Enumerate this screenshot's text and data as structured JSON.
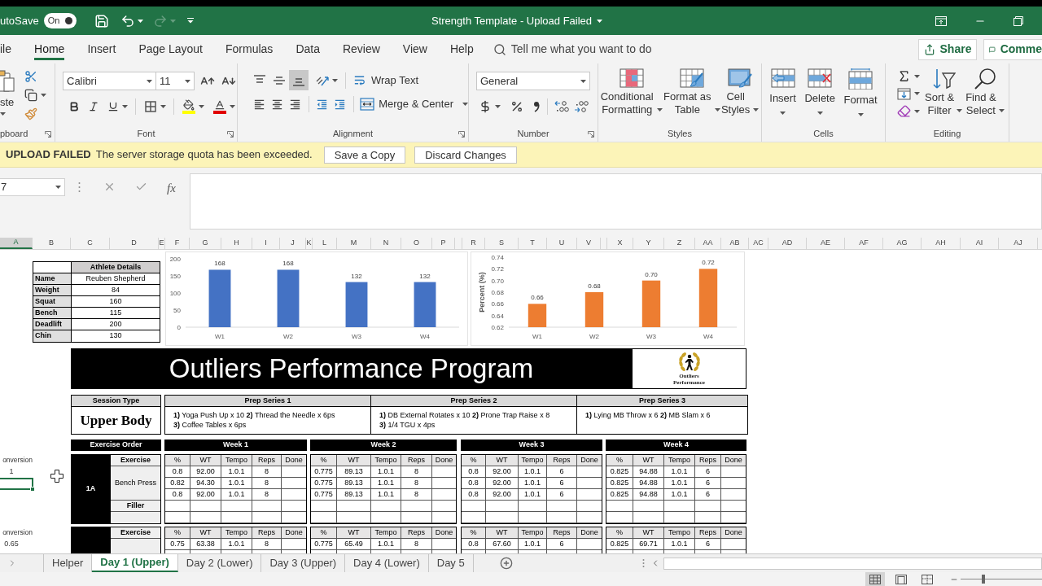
{
  "title_bar": {
    "autosave_label": "utoSave",
    "autosave_toggle": {
      "label": "On",
      "on": true
    },
    "redo_disabled": true,
    "title": "Strength Template - Upload Failed"
  },
  "ribbon_tabs": [
    {
      "label": "ile",
      "selected": false
    },
    {
      "label": "Home",
      "selected": true
    },
    {
      "label": "Insert",
      "selected": false
    },
    {
      "label": "Page Layout",
      "selected": false
    },
    {
      "label": "Formulas",
      "selected": false
    },
    {
      "label": "Data",
      "selected": false
    },
    {
      "label": "Review",
      "selected": false
    },
    {
      "label": "View",
      "selected": false
    },
    {
      "label": "Help",
      "selected": false
    }
  ],
  "tell_me": {
    "placeholder": "Tell me what you want to do"
  },
  "header_buttons": {
    "share": "Share",
    "comments": "Comme"
  },
  "ribbon": {
    "clipboard": {
      "paste_label": "ste",
      "group_label": "pboard"
    },
    "font": {
      "font_name": "Calibri",
      "font_size": "11",
      "group_label": "Font"
    },
    "alignment": {
      "vertical_align": [
        {
          "kind": "top",
          "selected": false
        },
        {
          "kind": "middle",
          "selected": false
        },
        {
          "kind": "bottom",
          "selected": true
        }
      ],
      "wrap_text": "Wrap Text",
      "merge_center": "Merge & Center",
      "group_label": "Alignment"
    },
    "number": {
      "format": "General",
      "group_label": "Number"
    },
    "styles": {
      "buttons": [
        {
          "kind": "conditional",
          "label": "Conditional\nFormatting"
        },
        {
          "kind": "format_table",
          "label": "Format as\nTable"
        },
        {
          "kind": "cell_styles",
          "label": "Cell\nStyles"
        }
      ],
      "group_label": "Styles"
    },
    "cells": {
      "buttons": [
        {
          "kind": "insert",
          "label": "Insert"
        },
        {
          "kind": "delete",
          "label": "Delete"
        },
        {
          "kind": "format",
          "label": "Format"
        }
      ],
      "group_label": "Cells"
    },
    "editing": {
      "buttons": [
        {
          "kind": "sort_filter",
          "label": "Sort &\nFilter"
        },
        {
          "kind": "find_select",
          "label": "Find &\nSelect"
        }
      ],
      "group_label": "Editing"
    }
  },
  "message_bar": {
    "title": "UPLOAD FAILED",
    "message": "The server storage quota has been exceeded.",
    "buttons": [
      "Save a Copy",
      "Discard Changes"
    ]
  },
  "formula_bar": {
    "name_box": "7",
    "function_button": "fx"
  },
  "columns": [
    {
      "label": "A",
      "selected": true
    },
    {
      "label": "B",
      "selected": false
    },
    {
      "label": "C",
      "selected": false
    },
    {
      "label": "D",
      "selected": false
    },
    {
      "label": "E",
      "selected": false
    },
    {
      "label": "F",
      "selected": false
    },
    {
      "label": "G",
      "selected": false
    },
    {
      "label": "H",
      "selected": false
    },
    {
      "label": "I",
      "selected": false
    },
    {
      "label": "J",
      "selected": false
    },
    {
      "label": "K",
      "selected": false
    },
    {
      "label": "L",
      "selected": false
    },
    {
      "label": "M",
      "selected": false
    },
    {
      "label": "N",
      "selected": false
    },
    {
      "label": "O",
      "selected": false
    },
    {
      "label": "P",
      "selected": false
    },
    {
      "selected": false
    },
    {
      "label": "R",
      "selected": false
    },
    {
      "label": "S",
      "selected": false
    },
    {
      "label": "T",
      "selected": false
    },
    {
      "label": "U",
      "selected": false
    },
    {
      "label": "V",
      "selected": false
    },
    {
      "selected": false
    },
    {
      "label": "X",
      "selected": false
    },
    {
      "label": "Y",
      "selected": false
    },
    {
      "label": "Z",
      "selected": false
    },
    {
      "label": "AA",
      "selected": false
    },
    {
      "label": "AB",
      "selected": false
    },
    {
      "label": "AC",
      "selected": false
    },
    {
      "label": "AD",
      "selected": false
    },
    {
      "label": "AE",
      "selected": false
    },
    {
      "label": "AF",
      "selected": false
    },
    {
      "label": "AG",
      "selected": false
    },
    {
      "label": "AH",
      "selected": false
    },
    {
      "label": "AI",
      "selected": false
    },
    {
      "label": "AJ",
      "selected": false
    }
  ],
  "athlete_details": {
    "header": "Athlete Details",
    "rows": [
      {
        "label": "Name",
        "value": "Reuben Shepherd"
      },
      {
        "label": "Weight",
        "value": "84"
      },
      {
        "label": "Squat",
        "value": "160"
      },
      {
        "label": "Bench",
        "value": "115"
      },
      {
        "label": "Deadlift",
        "value": "200"
      },
      {
        "label": "Chin",
        "value": "130"
      }
    ]
  },
  "charts": [
    {
      "chart_data": {
        "type": "bar",
        "categories": [
          "W1",
          "W2",
          "W3",
          "W4"
        ],
        "values": [
          168,
          168,
          132,
          132
        ],
        "color": "#4472c4",
        "yticks": [
          0,
          50,
          100,
          150,
          200
        ],
        "ylim": [
          0,
          200
        ],
        "data_labels": true
      }
    },
    {
      "chart_data": {
        "type": "bar",
        "ylabel": "Percent (%)",
        "categories": [
          "W1",
          "W2",
          "W3",
          "W4"
        ],
        "values": [
          0.66,
          0.68,
          0.7,
          0.72
        ],
        "color": "#ed7d31",
        "yticks": [
          {
            "value": 0.62,
            "label": "0.62"
          },
          {
            "value": 0.64,
            "label": "0.64"
          },
          {
            "value": 0.66,
            "label": "0.66"
          },
          {
            "value": 0.68,
            "label": "0.68"
          },
          {
            "value": 0.7,
            "label": "0.70"
          },
          {
            "value": 0.72,
            "label": "0.72"
          },
          {
            "value": 0.74,
            "label": "0.74"
          }
        ],
        "ylim": [
          0.62,
          0.74
        ],
        "value_labels": [
          "0.66",
          "0.68",
          "0.70",
          "0.72"
        ]
      }
    }
  ],
  "program": {
    "title": "Outliers Performance Program",
    "logo_text": "Outliers\nPerformance",
    "session_type": {
      "header": "Session Type",
      "value": "Upper Body"
    },
    "prep_series": [
      {
        "header": "Prep Series 1",
        "text": "**1)** Yoga Push Up x 10 **2)** Thread the Needle x 6ps\n**3)** Coffee Tables x 6ps"
      },
      {
        "header": "Prep Series 2",
        "text": "**1)** DB External Rotates x 10  **2)** Prone Trap Raise x 8\n**3)** 1/4 TGU x 4ps"
      },
      {
        "header": "Prep Series 3",
        "text": "**1)** Lying MB Throw x 6 **2)** MB Slam x 6"
      }
    ],
    "order_header": "Exercise Order",
    "weeks": [
      "Week 1",
      "Week 2",
      "Week 3",
      "Week 4"
    ]
  },
  "blocks": [
    {
      "side_label": "onversion",
      "side_value": "1",
      "active_cell": true,
      "order": "1A",
      "exercise_header": "Exercise",
      "exercise": "Bench Press",
      "filler_label": "Filler",
      "weeks": [
        {
          "columns": [
            "%",
            "WT",
            "Tempo",
            "Reps",
            "Done"
          ],
          "rows": [
            [
              "0.8",
              "92.00",
              "1.0.1",
              "8"
            ],
            [
              "0.82",
              "94.30",
              "1.0.1",
              "8"
            ],
            [
              "0.8",
              "92.00",
              "1.0.1",
              "8"
            ]
          ]
        },
        {
          "columns": [
            "%",
            "WT",
            "Tempo",
            "Reps",
            "Done"
          ],
          "rows": [
            [
              "0.775",
              "89.13",
              "1.0.1",
              "8"
            ],
            [
              "0.775",
              "89.13",
              "1.0.1",
              "8"
            ],
            [
              "0.775",
              "89.13",
              "1.0.1",
              "8"
            ]
          ]
        },
        {
          "columns": [
            "%",
            "WT",
            "Tempo",
            "Reps",
            "Done"
          ],
          "rows": [
            [
              "0.8",
              "92.00",
              "1.0.1",
              "6"
            ],
            [
              "0.8",
              "92.00",
              "1.0.1",
              "6"
            ],
            [
              "0.8",
              "92.00",
              "1.0.1",
              "6"
            ]
          ]
        },
        {
          "columns": [
            "%",
            "WT",
            "Tempo",
            "Reps",
            "Done"
          ],
          "rows": [
            [
              "0.825",
              "94.88",
              "1.0.1",
              "6"
            ],
            [
              "0.825",
              "94.88",
              "1.0.1",
              "6"
            ],
            [
              "0.825",
              "94.88",
              "1.0.1",
              "6"
            ]
          ]
        }
      ]
    },
    {
      "side_label": "onversion",
      "side_value": "0.65",
      "exercise_header": "Exercise",
      "weeks": [
        {
          "columns": [
            "%",
            "WT",
            "Tempo",
            "Reps",
            "Done"
          ],
          "rows": [
            [
              "0.75",
              "63.38",
              "1.0.1",
              "8"
            ]
          ]
        },
        {
          "columns": [
            "%",
            "WT",
            "Tempo",
            "Reps",
            "Done"
          ],
          "rows": [
            [
              "0.775",
              "65.49",
              "1.0.1",
              "8"
            ]
          ]
        },
        {
          "columns": [
            "%",
            "WT",
            "Tempo",
            "Reps",
            "Done"
          ],
          "rows": [
            [
              "0.8",
              "67.60",
              "1.0.1",
              "6"
            ]
          ]
        },
        {
          "columns": [
            "%",
            "WT",
            "Tempo",
            "Reps",
            "Done"
          ],
          "rows": [
            [
              "0.825",
              "69.71",
              "1.0.1",
              "6"
            ]
          ]
        }
      ]
    }
  ],
  "sheet_tabs": [
    {
      "label": "Helper",
      "selected": false
    },
    {
      "label": "Day 1 (Upper)",
      "selected": true
    },
    {
      "label": "Day 2 (Lower)",
      "selected": false
    },
    {
      "label": "Day 3 (Upper)",
      "selected": false
    },
    {
      "label": "Day 4 (Lower)",
      "selected": false
    },
    {
      "label": "Day 5",
      "selected": false
    }
  ],
  "status_bar": {
    "views": [
      {
        "kind": "normal",
        "selected": true
      },
      {
        "kind": "page_layout",
        "selected": false
      },
      {
        "kind": "page_break",
        "selected": false
      }
    ],
    "zoom": {
      "level": 0.28
    }
  }
}
